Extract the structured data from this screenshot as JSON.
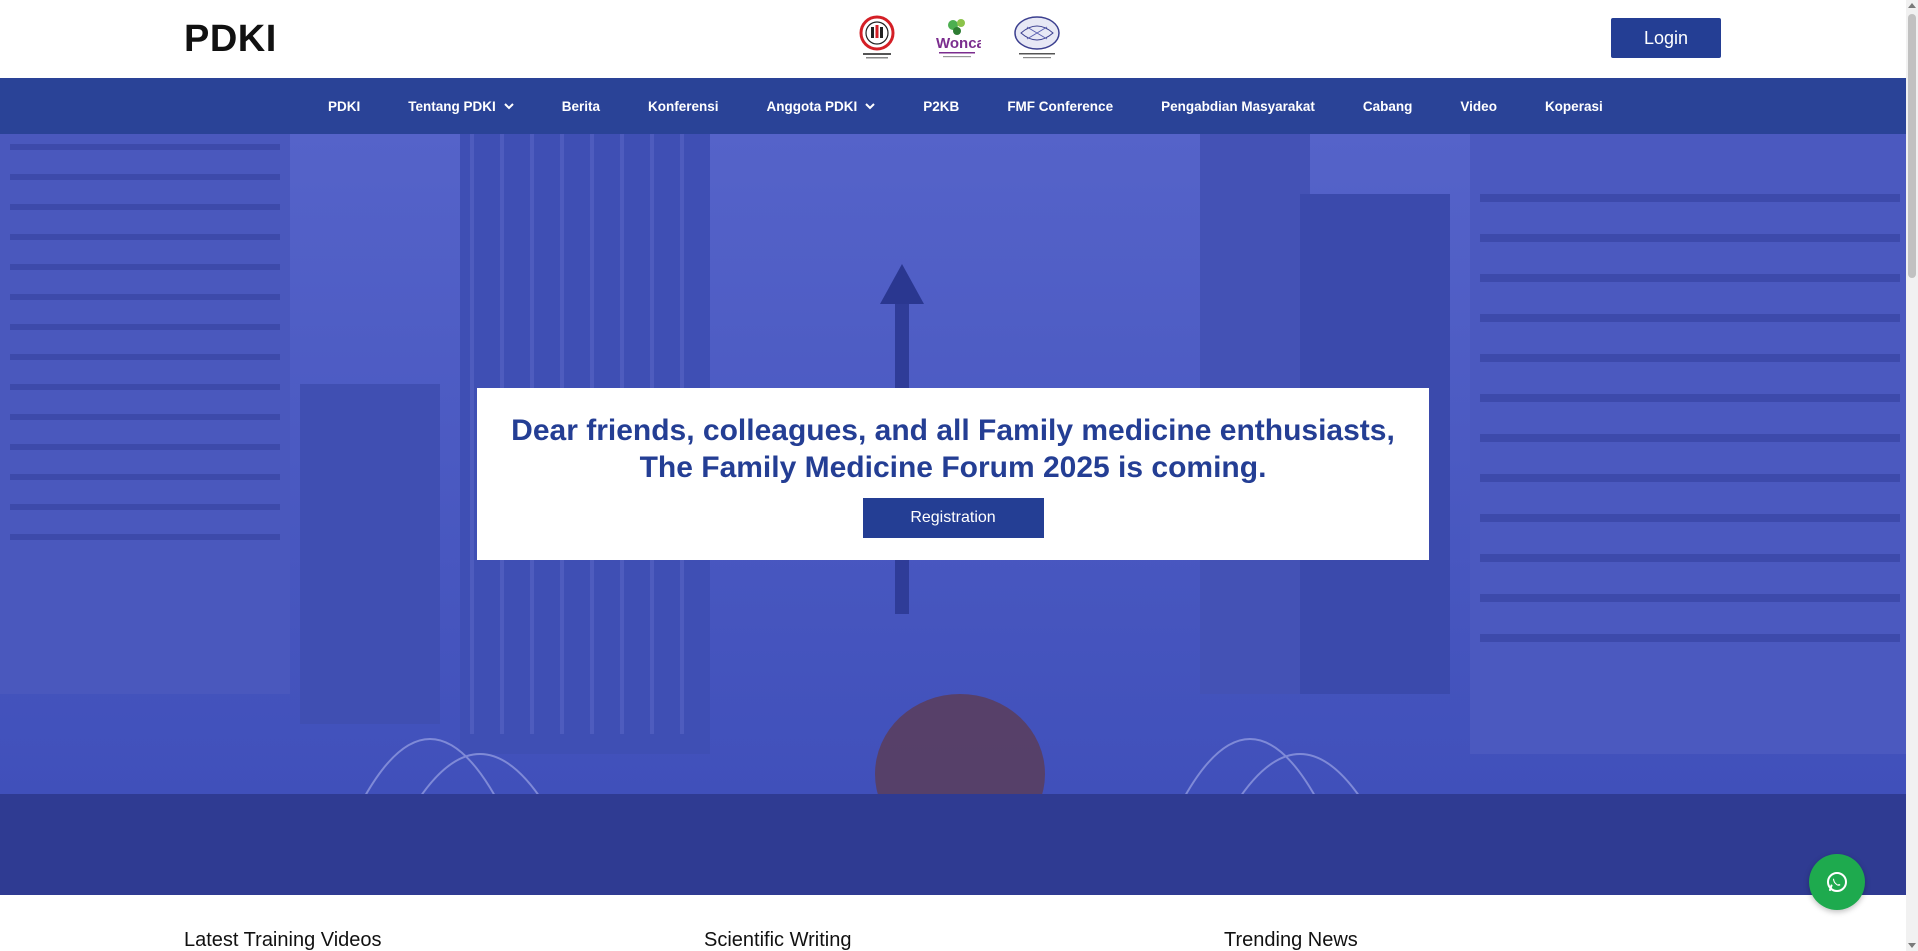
{
  "header": {
    "brand": "PDKI",
    "logos": [
      "idi-logo",
      "wonca-logo",
      "family-physicians-logo"
    ],
    "login_label": "Login"
  },
  "nav": {
    "items": [
      {
        "label": "PDKI",
        "has_dropdown": false
      },
      {
        "label": "Tentang PDKI",
        "has_dropdown": true
      },
      {
        "label": "Berita",
        "has_dropdown": false
      },
      {
        "label": "Konferensi",
        "has_dropdown": false
      },
      {
        "label": "Anggota PDKI",
        "has_dropdown": true
      },
      {
        "label": "P2KB",
        "has_dropdown": false
      },
      {
        "label": "FMF Conference",
        "has_dropdown": false
      },
      {
        "label": "Pengabdian Masyarakat",
        "has_dropdown": false
      },
      {
        "label": "Cabang",
        "has_dropdown": false
      },
      {
        "label": "Video",
        "has_dropdown": false
      },
      {
        "label": "Koperasi",
        "has_dropdown": false
      }
    ]
  },
  "hero": {
    "title": "Dear friends, colleagues, and all Family medicine enthusiasts, The Family Medicine Forum 2025 is coming.",
    "registration_label": "Registration"
  },
  "sections": {
    "training_videos": "Latest Training Videos",
    "scientific_writing": "Scientific Writing",
    "trending_news": "Trending News"
  },
  "colors": {
    "primary": "#243e94",
    "nav_bg": "#2a4397",
    "whatsapp": "#1eaa4e"
  },
  "icons": {
    "whatsapp": "whatsapp-icon",
    "dropdown": "chevron-down-icon"
  }
}
